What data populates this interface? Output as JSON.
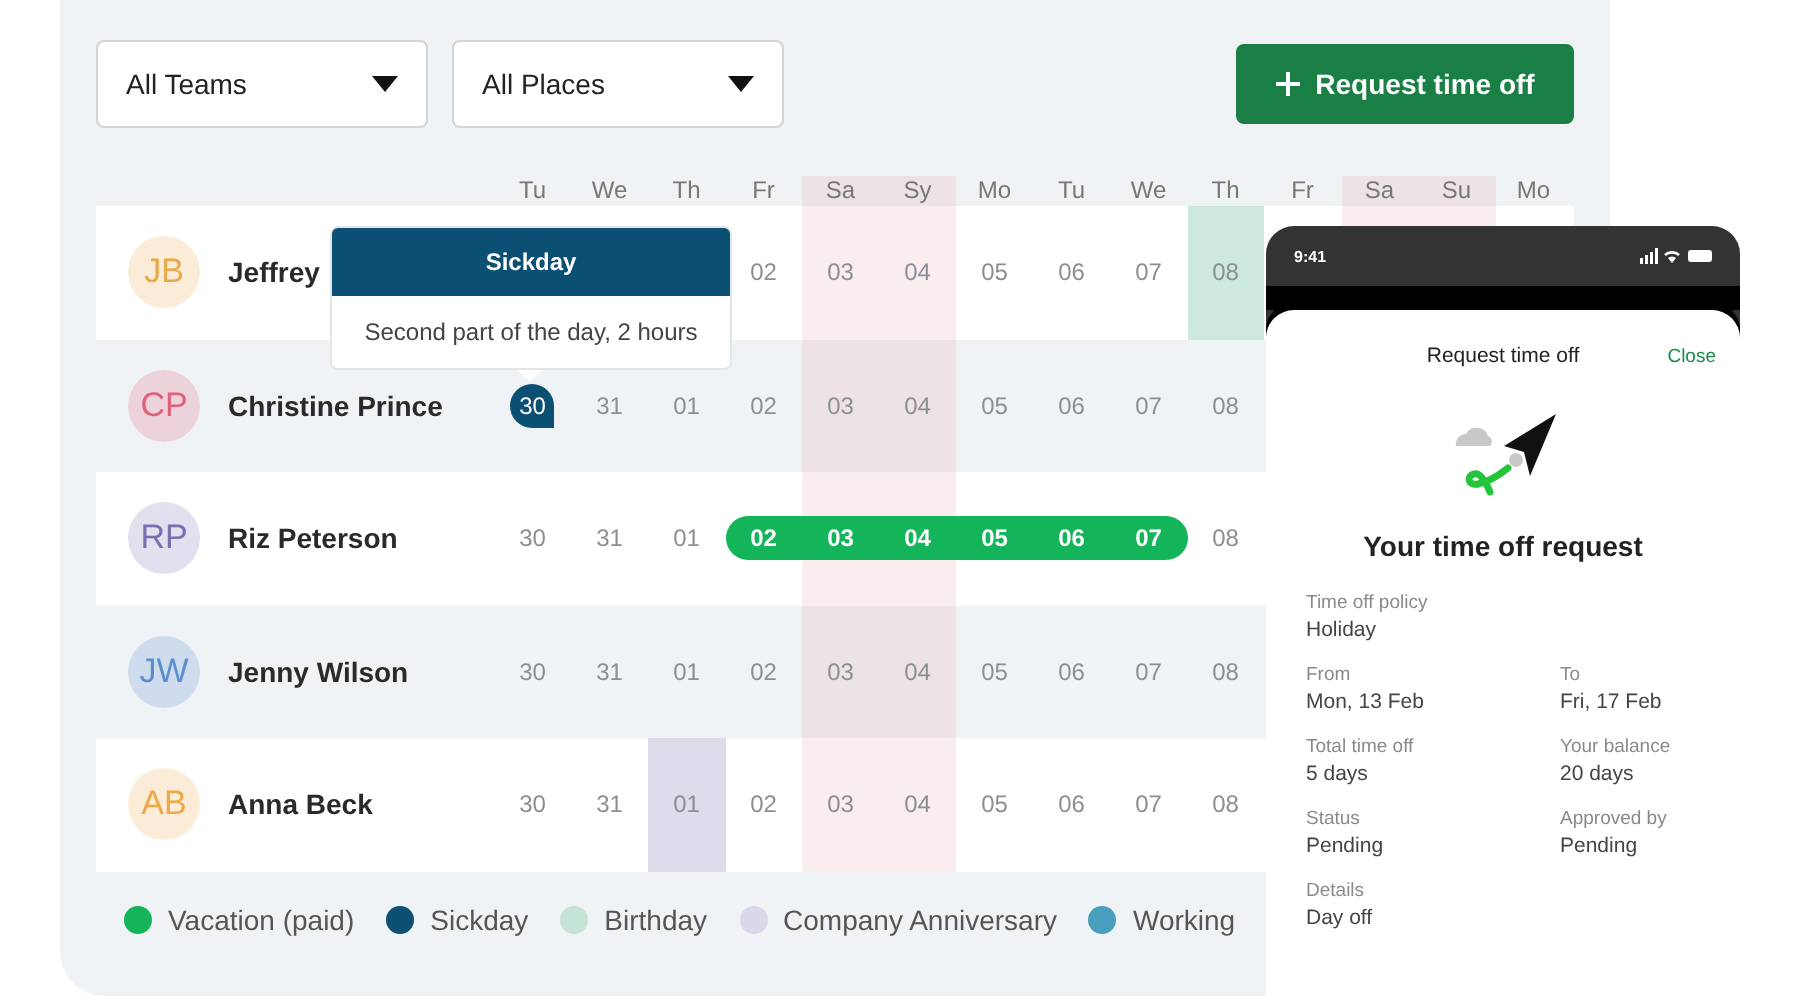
{
  "filters": [
    {
      "label": "All Teams"
    },
    {
      "label": "All Places"
    }
  ],
  "request_button": {
    "label": "Request time off"
  },
  "calendar": {
    "weekdays": [
      {
        "label": "Tu",
        "weekend": false
      },
      {
        "label": "We",
        "weekend": false
      },
      {
        "label": "Th",
        "weekend": false
      },
      {
        "label": "Fr",
        "weekend": false
      },
      {
        "label": "Sa",
        "weekend": true
      },
      {
        "label": "Sy",
        "weekend": true
      },
      {
        "label": "Mo",
        "weekend": false
      },
      {
        "label": "Tu",
        "weekend": false
      },
      {
        "label": "We",
        "weekend": false
      },
      {
        "label": "Th",
        "weekend": false
      },
      {
        "label": "Fr",
        "weekend": false
      },
      {
        "label": "Sa",
        "weekend": true
      },
      {
        "label": "Su",
        "weekend": true
      },
      {
        "label": "Mo",
        "weekend": false
      }
    ],
    "members": [
      {
        "initials": "JB",
        "name": "Jeffrey",
        "color": "#e8a94a",
        "days": [
          {
            "kind": "plain"
          },
          {
            "kind": "plain"
          },
          {
            "kind": "plain"
          },
          {
            "text": "02",
            "kind": "plain"
          },
          {
            "text": "03",
            "kind": "plain"
          },
          {
            "text": "04",
            "kind": "plain"
          },
          {
            "text": "05",
            "kind": "plain"
          },
          {
            "text": "06",
            "kind": "plain"
          },
          {
            "text": "07",
            "kind": "plain"
          },
          {
            "text": "08",
            "kind": "birthday"
          }
        ]
      },
      {
        "initials": "CP",
        "name": "Christine Prince",
        "color": "#e0607a",
        "days": [
          {
            "text": "30",
            "kind": "sickday"
          },
          {
            "text": "31",
            "kind": "plain"
          },
          {
            "text": "01",
            "kind": "plain"
          },
          {
            "text": "02",
            "kind": "plain"
          },
          {
            "text": "03",
            "kind": "plain"
          },
          {
            "text": "04",
            "kind": "plain"
          },
          {
            "text": "05",
            "kind": "plain"
          },
          {
            "text": "06",
            "kind": "plain"
          },
          {
            "text": "07",
            "kind": "plain"
          },
          {
            "text": "08",
            "kind": "plain"
          }
        ]
      },
      {
        "initials": "RP",
        "name": "Riz Peterson",
        "color": "#7a6fb0",
        "days": [
          {
            "text": "30",
            "kind": "plain"
          },
          {
            "text": "31",
            "kind": "plain"
          },
          {
            "text": "01",
            "kind": "plain"
          },
          {
            "text": "02",
            "kind": "vacation"
          },
          {
            "text": "03",
            "kind": "vacation"
          },
          {
            "text": "04",
            "kind": "vacation"
          },
          {
            "text": "05",
            "kind": "vacation"
          },
          {
            "text": "06",
            "kind": "vacation"
          },
          {
            "text": "07",
            "kind": "vacation"
          },
          {
            "text": "08",
            "kind": "plain"
          }
        ]
      },
      {
        "initials": "JW",
        "name": "Jenny Wilson",
        "color": "#5b8fd0",
        "days": [
          {
            "text": "30",
            "kind": "plain"
          },
          {
            "text": "31",
            "kind": "plain"
          },
          {
            "text": "01",
            "kind": "plain"
          },
          {
            "text": "02",
            "kind": "plain"
          },
          {
            "text": "03",
            "kind": "plain"
          },
          {
            "text": "04",
            "kind": "plain"
          },
          {
            "text": "05",
            "kind": "plain"
          },
          {
            "text": "06",
            "kind": "plain"
          },
          {
            "text": "07",
            "kind": "plain"
          },
          {
            "text": "08",
            "kind": "plain"
          }
        ]
      },
      {
        "initials": "AB",
        "name": "Anna Beck",
        "color": "#efa848",
        "days": [
          {
            "text": "30",
            "kind": "plain"
          },
          {
            "text": "31",
            "kind": "plain"
          },
          {
            "text": "01",
            "kind": "anniversary"
          },
          {
            "text": "02",
            "kind": "plain"
          },
          {
            "text": "03",
            "kind": "plain"
          },
          {
            "text": "04",
            "kind": "plain"
          },
          {
            "text": "05",
            "kind": "plain"
          },
          {
            "text": "06",
            "kind": "plain"
          },
          {
            "text": "07",
            "kind": "plain"
          },
          {
            "text": "08",
            "kind": "plain"
          }
        ]
      }
    ]
  },
  "legend": [
    {
      "label": "Vacation (paid)",
      "color": "#13b45a"
    },
    {
      "label": "Sickday",
      "color": "#0b4f73"
    },
    {
      "label": "Birthday",
      "color": "#c5e4d6"
    },
    {
      "label": "Company Anniversary",
      "color": "#d8d8e8"
    },
    {
      "label": "Working",
      "color": "#4a9fbf"
    }
  ],
  "tooltip": {
    "title": "Sickday",
    "text": "Second part of the day, 2 hours"
  },
  "phone": {
    "time": "9:41",
    "header": "Request time off",
    "close": "Close",
    "title": "Your time off request",
    "rows": [
      [
        {
          "label": "Time off policy",
          "value": "Holiday"
        }
      ],
      [
        {
          "label": "From",
          "value": "Mon, 13 Feb"
        },
        {
          "label": "To",
          "value": "Fri, 17 Feb"
        }
      ],
      [
        {
          "label": "Total time off",
          "value": "5 days"
        },
        {
          "label": "Your balance",
          "value": "20 days"
        }
      ],
      [
        {
          "label": "Status",
          "value": "Pending"
        },
        {
          "label": "Approved by",
          "value": "Pending"
        }
      ],
      [
        {
          "label": "Details",
          "value": "Day off"
        }
      ]
    ]
  }
}
